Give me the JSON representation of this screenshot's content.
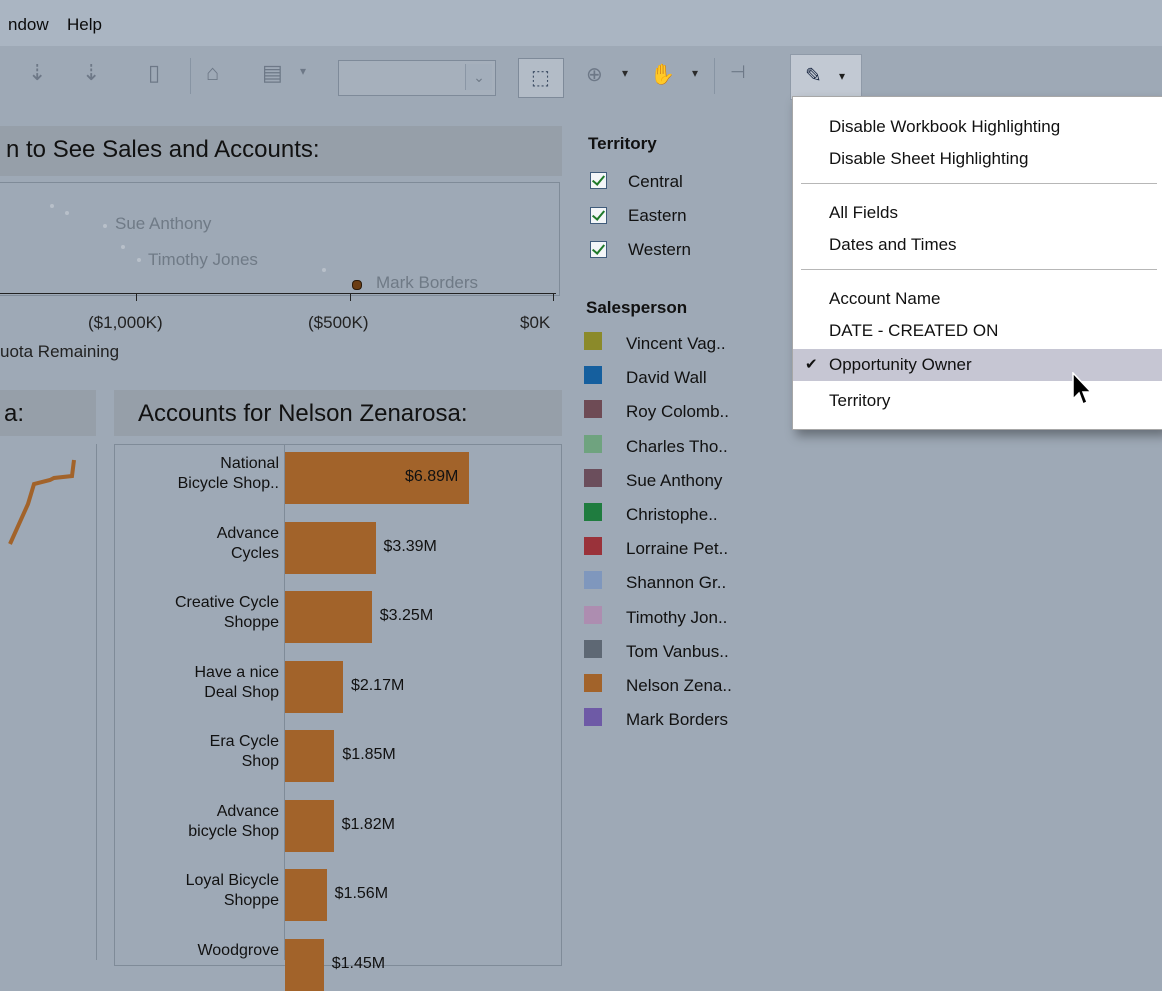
{
  "menubar": {
    "items": [
      "ndow",
      "Help"
    ]
  },
  "toolbar": {
    "dropdown_value": ""
  },
  "scatter": {
    "title": "n to See Sales and Accounts:",
    "points": [
      "Sue Anthony",
      "Timothy Jones",
      "Mark Borders"
    ],
    "ticks": [
      "($1,000K)",
      "($500K)",
      "$0K"
    ],
    "axis_label": "uota Remaining"
  },
  "left_panel": {
    "title": "a:"
  },
  "accounts": {
    "title": "Accounts for Nelson Zenarosa:",
    "bar_color": "#a2632a"
  },
  "chart_data": {
    "type": "bar",
    "title": "Accounts for Nelson Zenarosa:",
    "categories": [
      [
        "National",
        "Bicycle Shop.."
      ],
      [
        "Advance",
        "Cycles"
      ],
      [
        "Creative Cycle",
        "Shoppe"
      ],
      [
        "Have a nice",
        "Deal Shop"
      ],
      [
        "Era Cycle",
        "Shop"
      ],
      [
        "Advance",
        "bicycle Shop"
      ],
      [
        "Loyal Bicycle",
        "Shoppe"
      ],
      [
        "Woodgrove",
        ""
      ]
    ],
    "values": [
      6.89,
      3.39,
      3.25,
      2.17,
      1.85,
      1.82,
      1.56,
      1.45
    ],
    "labels": [
      "$6.89M",
      "$3.39M",
      "$3.25M",
      "$2.17M",
      "$1.85M",
      "$1.82M",
      "$1.56M",
      "$1.45M"
    ],
    "xlim": [
      0,
      7.4
    ]
  },
  "territory": {
    "title": "Territory",
    "items": [
      "Central",
      "Eastern",
      "Western"
    ]
  },
  "salesperson": {
    "title": "Salesperson",
    "items": [
      {
        "name": "Vincent Vag..",
        "color": "#8b8a2a"
      },
      {
        "name": "David Wall",
        "color": "#155f9e"
      },
      {
        "name": "Roy Colomb..",
        "color": "#6e4b55"
      },
      {
        "name": "Charles Tho..",
        "color": "#6fa37f"
      },
      {
        "name": "Sue Anthony",
        "color": "#6b4e5c"
      },
      {
        "name": "Christophe..",
        "color": "#1f7c3f"
      },
      {
        "name": "Lorraine Pet..",
        "color": "#9a323a"
      },
      {
        "name": "Shannon Gr..",
        "color": "#7f97bd"
      },
      {
        "name": "Timothy Jon..",
        "color": "#ad8db0"
      },
      {
        "name": "Tom Vanbus..",
        "color": "#5e6874"
      },
      {
        "name": "Nelson Zena..",
        "color": "#a2632a"
      },
      {
        "name": "Mark Borders",
        "color": "#6e5aa6"
      }
    ]
  },
  "highlight_menu": {
    "items_top": [
      "Disable Workbook Highlighting",
      "Disable Sheet Highlighting"
    ],
    "items_mid": [
      "All Fields",
      "Dates and Times"
    ],
    "items_bottom": [
      "Account Name",
      "DATE - CREATED ON",
      "Opportunity Owner",
      "Territory"
    ],
    "selected": "Opportunity Owner"
  }
}
